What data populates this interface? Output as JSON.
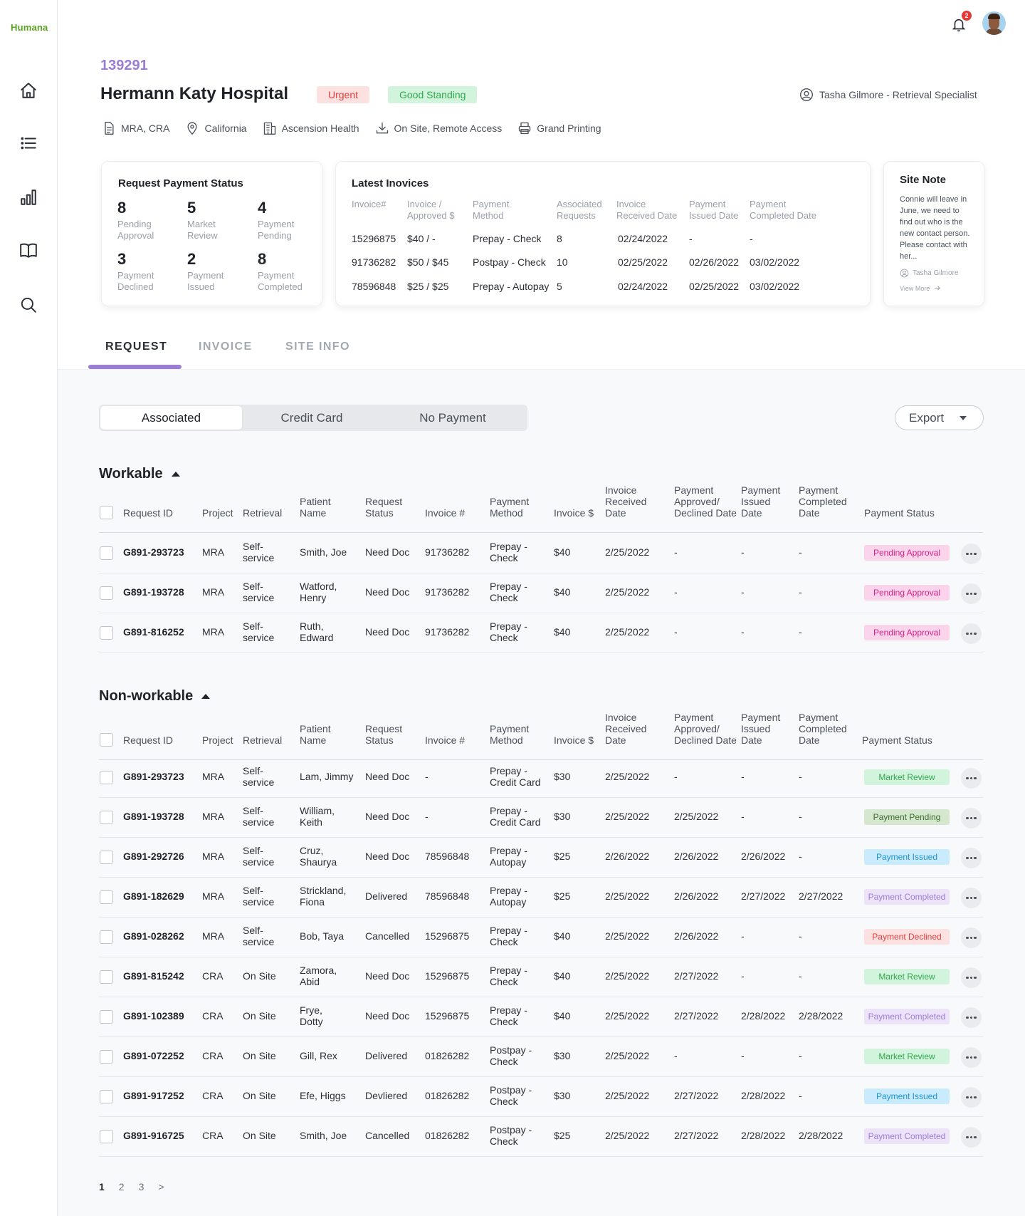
{
  "brand": {
    "logo": "Humana"
  },
  "topbar": {
    "notification_count": "2"
  },
  "sidebar": {
    "icons": [
      "home-icon",
      "list-icon",
      "bar-chart-icon",
      "book-icon",
      "search-icon"
    ]
  },
  "header": {
    "site_id": "139291",
    "site_name": "Hermann Katy Hospital",
    "badge_urgent": "Urgent",
    "badge_standing": "Good Standing",
    "specialist": "Tasha Gilmore - Retrieval Specialist",
    "meta": [
      {
        "icon": "document-icon",
        "label": "MRA, CRA"
      },
      {
        "icon": "location-pin-icon",
        "label": "California"
      },
      {
        "icon": "building-icon",
        "label": "Ascension Health"
      },
      {
        "icon": "download-icon",
        "label": "On Site, Remote Access"
      },
      {
        "icon": "printer-icon",
        "label": "Grand Printing"
      }
    ]
  },
  "payment_status": {
    "title": "Request Payment Status",
    "stats": [
      {
        "num": "8",
        "label1": "Pending",
        "label2": "Approval"
      },
      {
        "num": "5",
        "label1": "Market",
        "label2": "Review"
      },
      {
        "num": "4",
        "label1": "Payment",
        "label2": "Pending"
      },
      {
        "num": "3",
        "label1": "Payment",
        "label2": "Declined"
      },
      {
        "num": "2",
        "label1": "Payment",
        "label2": "Issued"
      },
      {
        "num": "8",
        "label1": "Payment",
        "label2": "Completed"
      }
    ]
  },
  "latest_invoices": {
    "title": "Latest Inovices",
    "headers": [
      {
        "l1": "Invoice#",
        "l2": ""
      },
      {
        "l1": "Invoice /",
        "l2": "Approved $"
      },
      {
        "l1": "Payment",
        "l2": "Method"
      },
      {
        "l1": "Associated",
        "l2": "Requests"
      },
      {
        "l1": "Invoice",
        "l2": "Received Date"
      },
      {
        "l1": "Payment",
        "l2": "Issued Date"
      },
      {
        "l1": "Payment",
        "l2": "Completed Date"
      }
    ],
    "rows": [
      [
        "15296875",
        "$40 / -",
        "Prepay - Check",
        "8",
        "02/24/2022",
        "-",
        "-"
      ],
      [
        "91736282",
        "$50 / $45",
        "Postpay - Check",
        "10",
        "02/25/2022",
        "02/26/2022",
        "03/02/2022"
      ],
      [
        "78596848",
        "$25 / $25",
        "Prepay - Autopay",
        "5",
        "02/24/2022",
        "02/25/2022",
        "03/02/2022"
      ]
    ]
  },
  "site_note": {
    "title": "Site Note",
    "text": "Connie will leave in June, we need to find out who is the new contact person. Please contact with her...",
    "author": "Tasha Gilmore",
    "view_more": "View More"
  },
  "tabs": [
    "REQUEST",
    "INVOICE",
    "SITE INFO"
  ],
  "segments": [
    "Associated",
    "Credit Card",
    "No Payment"
  ],
  "export_label": "Export",
  "table_headers": [
    {
      "l1": "",
      "l2": "",
      "l3": "Request ID"
    },
    {
      "l1": "",
      "l2": "",
      "l3": "Project"
    },
    {
      "l1": "",
      "l2": "",
      "l3": "Retrieval"
    },
    {
      "l1": "",
      "l2": "Patient",
      "l3": "Name"
    },
    {
      "l1": "",
      "l2": "Request",
      "l3": "Status"
    },
    {
      "l1": "",
      "l2": "",
      "l3": "Invoice #"
    },
    {
      "l1": "",
      "l2": "Payment",
      "l3": "Method"
    },
    {
      "l1": "",
      "l2": "",
      "l3": "Invoice $"
    },
    {
      "l1": "Invoice",
      "l2": "Received",
      "l3": "Date"
    },
    {
      "l1": "Payment",
      "l2": "Approved/",
      "l3": "Declined Date"
    },
    {
      "l1": "Payment",
      "l2": "Issued",
      "l3": "Date"
    },
    {
      "l1": "Payment",
      "l2": "Completed",
      "l3": "Date"
    },
    {
      "l1": "",
      "l2": "",
      "l3": "Payment Status"
    }
  ],
  "workable": {
    "title": "Workable",
    "rows": [
      {
        "id": "G891-293723",
        "project": "MRA",
        "retrieval": [
          "Self-",
          "service"
        ],
        "patient": [
          "Smith, Joe"
        ],
        "status": "Need Doc",
        "invoice": "91736282",
        "method": [
          "Prepay -",
          "Check"
        ],
        "amount": "$40",
        "received": "2/25/2022",
        "approved": "-",
        "issued": "-",
        "completed": "-",
        "pay_status": "Pending Approval",
        "pill": "pink"
      },
      {
        "id": "G891-193728",
        "project": "MRA",
        "retrieval": [
          "Self-",
          "service"
        ],
        "patient": [
          "Watford,",
          "Henry"
        ],
        "status": "Need Doc",
        "invoice": "91736282",
        "method": [
          "Prepay -",
          "Check"
        ],
        "amount": "$40",
        "received": "2/25/2022",
        "approved": "-",
        "issued": "-",
        "completed": "-",
        "pay_status": "Pending Approval",
        "pill": "pink"
      },
      {
        "id": "G891-816252",
        "project": "MRA",
        "retrieval": [
          "Self-",
          "service"
        ],
        "patient": [
          "Ruth,",
          "Edward"
        ],
        "status": "Need Doc",
        "invoice": "91736282",
        "method": [
          "Prepay -",
          "Check"
        ],
        "amount": "$40",
        "received": "2/25/2022",
        "approved": "-",
        "issued": "-",
        "completed": "-",
        "pay_status": "Pending Approval",
        "pill": "pink"
      }
    ]
  },
  "nonworkable": {
    "title": "Non-workable",
    "rows": [
      {
        "id": "G891-293723",
        "project": "MRA",
        "retrieval": [
          "Self-",
          "service"
        ],
        "patient": [
          "Lam, Jimmy"
        ],
        "status": "Need Doc",
        "invoice": "-",
        "method": [
          "Prepay -",
          "Credit Card"
        ],
        "amount": "$30",
        "received": "2/25/2022",
        "approved": "-",
        "issued": "-",
        "completed": "-",
        "pay_status": "Market Review",
        "pill": "green"
      },
      {
        "id": "G891-193728",
        "project": "MRA",
        "retrieval": [
          "Self-",
          "service"
        ],
        "patient": [
          "William,",
          "Keith"
        ],
        "status": "Need Doc",
        "invoice": "-",
        "method": [
          "Prepay -",
          "Credit Card"
        ],
        "amount": "$30",
        "received": "2/25/2022",
        "approved": "2/25/2022",
        "issued": "-",
        "completed": "-",
        "pay_status": "Payment Pending",
        "pill": "olive"
      },
      {
        "id": "G891-292726",
        "project": "MRA",
        "retrieval": [
          "Self-",
          "service"
        ],
        "patient": [
          "Cruz,",
          "Shaurya"
        ],
        "status": "Need Doc",
        "invoice": "78596848",
        "method": [
          "Prepay -",
          "Autopay"
        ],
        "amount": "$25",
        "received": "2/26/2022",
        "approved": "2/26/2022",
        "issued": "2/26/2022",
        "completed": "-",
        "pay_status": "Payment Issued",
        "pill": "blue"
      },
      {
        "id": "G891-182629",
        "project": "MRA",
        "retrieval": [
          "Self-",
          "service"
        ],
        "patient": [
          "Strickland,",
          "Fiona"
        ],
        "status": "Delivered",
        "invoice": "78596848",
        "method": [
          "Prepay -",
          "Autopay"
        ],
        "amount": "$25",
        "received": "2/25/2022",
        "approved": "2/26/2022",
        "issued": "2/27/2022",
        "completed": "2/27/2022",
        "pay_status": "Payment Completed",
        "pill": "purple"
      },
      {
        "id": "G891-028262",
        "project": "MRA",
        "retrieval": [
          "Self-",
          "service"
        ],
        "patient": [
          "Bob, Taya"
        ],
        "status": "Cancelled",
        "invoice": "15296875",
        "method": [
          "Prepay -",
          "Check"
        ],
        "amount": "$40",
        "received": "2/25/2022",
        "approved": "2/26/2022",
        "issued": "-",
        "completed": "-",
        "pay_status": "Payment Declined",
        "pill": "red"
      },
      {
        "id": "G891-815242",
        "project": "CRA",
        "retrieval": [
          "On Site"
        ],
        "patient": [
          "Zamora,",
          "Abid"
        ],
        "status": "Need Doc",
        "invoice": "15296875",
        "method": [
          "Prepay -",
          "Check"
        ],
        "amount": "$40",
        "received": "2/25/2022",
        "approved": "2/27/2022",
        "issued": "-",
        "completed": "-",
        "pay_status": "Market Review",
        "pill": "green"
      },
      {
        "id": "G891-102389",
        "project": "CRA",
        "retrieval": [
          "On Site"
        ],
        "patient": [
          "Frye,",
          "Dotty"
        ],
        "status": "Need Doc",
        "invoice": "15296875",
        "method": [
          "Prepay -",
          "Check"
        ],
        "amount": "$40",
        "received": "2/25/2022",
        "approved": "2/27/2022",
        "issued": "2/28/2022",
        "completed": "2/28/2022",
        "pay_status": "Payment Completed",
        "pill": "purple"
      },
      {
        "id": "G891-072252",
        "project": "CRA",
        "retrieval": [
          "On Site"
        ],
        "patient": [
          "Gill, Rex"
        ],
        "status": "Delivered",
        "invoice": "01826282",
        "method": [
          "Postpay -",
          "Check"
        ],
        "amount": "$30",
        "received": "2/25/2022",
        "approved": "-",
        "issued": "-",
        "completed": "-",
        "pay_status": "Market Review",
        "pill": "green"
      },
      {
        "id": "G891-917252",
        "project": "CRA",
        "retrieval": [
          "On Site"
        ],
        "patient": [
          "Efe, Higgs"
        ],
        "status": "Devliered",
        "invoice": "01826282",
        "method": [
          "Postpay -",
          "Check"
        ],
        "amount": "$30",
        "received": "2/25/2022",
        "approved": "2/27/2022",
        "issued": "2/28/2022",
        "completed": "-",
        "pay_status": "Payment Issued",
        "pill": "blue"
      },
      {
        "id": "G891-916725",
        "project": "CRA",
        "retrieval": [
          "On Site"
        ],
        "patient": [
          "Smith, Joe"
        ],
        "status": "Cancelled",
        "invoice": "01826282",
        "method": [
          "Postpay -",
          "Check"
        ],
        "amount": "$25",
        "received": "2/25/2022",
        "approved": "2/27/2022",
        "issued": "2/28/2022",
        "completed": "2/28/2022",
        "pay_status": "Payment Completed",
        "pill": "purple"
      }
    ]
  },
  "pill_colors": {
    "pink": {
      "bg": "#fbd3ea",
      "fg": "#d6248a"
    },
    "green": {
      "bg": "#d3f4dc",
      "fg": "#2fa84f"
    },
    "olive": {
      "bg": "#d5e8cf",
      "fg": "#3c6b2d"
    },
    "blue": {
      "bg": "#c9ebfb",
      "fg": "#1e93d6"
    },
    "purple": {
      "bg": "#ece3f8",
      "fg": "#9b7dd4"
    },
    "red": {
      "bg": "#fde0e0",
      "fg": "#e0403b"
    }
  },
  "pagination": [
    "1",
    "2",
    "3",
    ">"
  ]
}
